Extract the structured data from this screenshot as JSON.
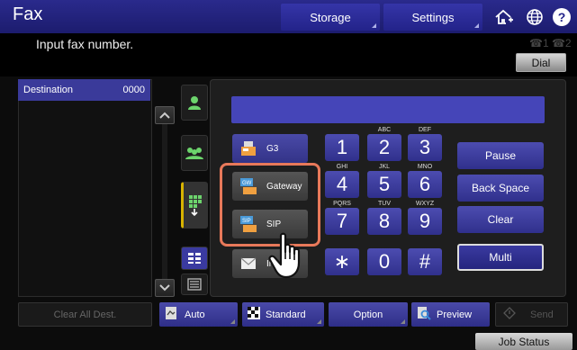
{
  "header": {
    "title": "Fax",
    "storage_label": "Storage",
    "settings_label": "Settings",
    "home_icon": "home-plus-icon",
    "globe_icon": "globe-icon",
    "help_label": "?"
  },
  "message": {
    "instruction": "Input fax number.",
    "line_icons": "☎1 ☎2",
    "dial_label": "Dial"
  },
  "destination": {
    "label": "Destination",
    "count": "0000"
  },
  "tabs": [
    {
      "name": "address-book",
      "icon": "person-icon"
    },
    {
      "name": "group",
      "icon": "group-icon"
    },
    {
      "name": "keypad",
      "icon": "keypad-icon"
    },
    {
      "name": "list-view",
      "icon": "list-icon"
    },
    {
      "name": "detail-view",
      "icon": "detail-icon"
    }
  ],
  "modes": {
    "g3": "G3",
    "gateway": "Gateway",
    "sip": "SIP",
    "internet": "In"
  },
  "keypad": {
    "k1": "1",
    "k2": "2",
    "k3": "3",
    "k4": "4",
    "k5": "5",
    "k6": "6",
    "k7": "7",
    "k8": "8",
    "k9": "9",
    "kstar": "∗",
    "k0": "0",
    "khash": "#",
    "s2": "ABC",
    "s3": "DEF",
    "s4": "GHI",
    "s5": "JKL",
    "s6": "MNO",
    "s7": "PQRS",
    "s8": "TUV",
    "s9": "WXYZ"
  },
  "functions": {
    "pause": "Pause",
    "backspace": "Back Space",
    "clear": "Clear",
    "multi": "Multi"
  },
  "bottom": {
    "clear_all": "Clear All Dest.",
    "auto": "Auto",
    "standard": "Standard",
    "option": "Option",
    "preview": "Preview",
    "send": "Send",
    "job_status": "Job Status"
  },
  "colors": {
    "header_blue": "#23238a",
    "key_blue": "#3d3d9e",
    "highlight": "#e8795a"
  }
}
